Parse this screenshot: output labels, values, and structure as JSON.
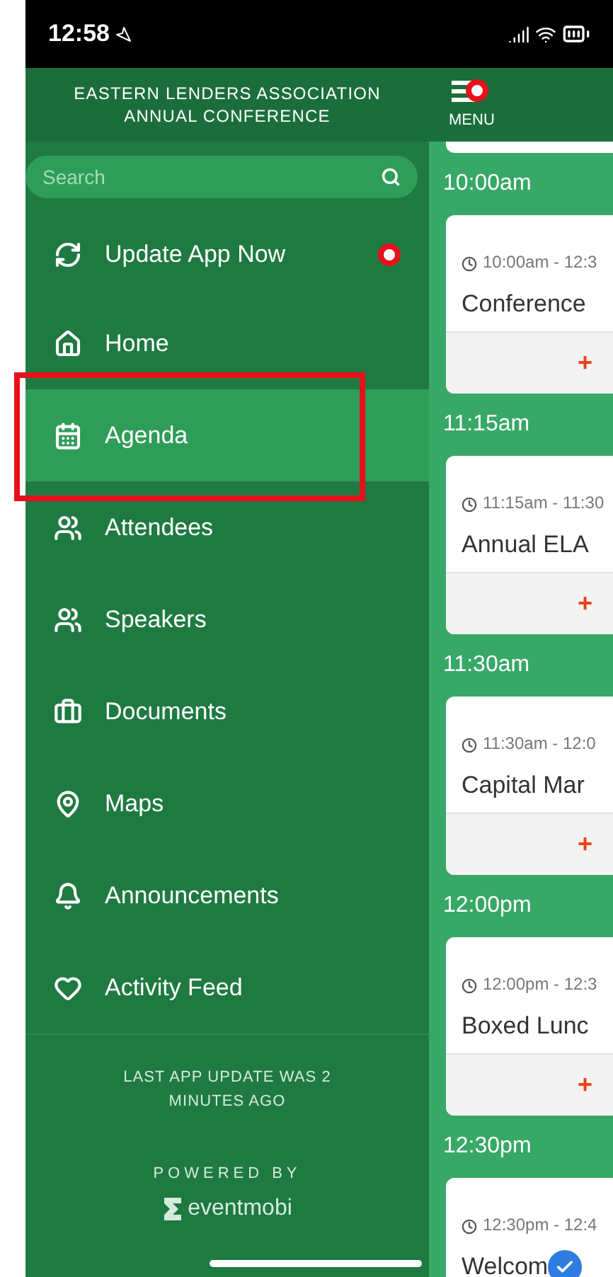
{
  "status_bar": {
    "time": "12:58"
  },
  "sidebar": {
    "title": "EASTERN LENDERS ASSOCIATION ANNUAL CONFERENCE",
    "search": {
      "placeholder": "Search"
    },
    "items": [
      {
        "kind": "update",
        "label": "Update App Now",
        "selected": false,
        "badge": true
      },
      {
        "kind": "home",
        "label": "Home",
        "selected": false,
        "badge": false
      },
      {
        "kind": "agenda",
        "label": "Agenda",
        "selected": true,
        "badge": false,
        "highlighted": true
      },
      {
        "kind": "attendees",
        "label": "Attendees",
        "selected": false,
        "badge": false
      },
      {
        "kind": "speakers",
        "label": "Speakers",
        "selected": false,
        "badge": false
      },
      {
        "kind": "documents",
        "label": "Documents",
        "selected": false,
        "badge": false
      },
      {
        "kind": "maps",
        "label": "Maps",
        "selected": false,
        "badge": false
      },
      {
        "kind": "announcements",
        "label": "Announcements",
        "selected": false,
        "badge": false
      },
      {
        "kind": "feed",
        "label": "Activity Feed",
        "selected": false,
        "badge": false
      }
    ],
    "last_update": "LAST APP UPDATE WAS 2 MINUTES AGO",
    "powered_by": "POWERED BY",
    "brand": "eventmobi"
  },
  "main": {
    "menu_label": "MENU",
    "menu_badge": true,
    "sessions": [
      {
        "time": "10:00am",
        "range": "10:00am - 12:3",
        "title": "Conference",
        "action": "+"
      },
      {
        "time": "11:15am",
        "range": "11:15am - 11:30",
        "title": "Annual ELA",
        "action": "+"
      },
      {
        "time": "11:30am",
        "range": "11:30am - 12:0",
        "title": "Capital Mar",
        "action": "+"
      },
      {
        "time": "12:00pm",
        "range": "12:00pm - 12:3",
        "title": "Boxed Lunc",
        "action": "+"
      },
      {
        "time": "12:30pm",
        "range": "12:30pm - 12:4",
        "title": "Welcom"
      }
    ]
  }
}
